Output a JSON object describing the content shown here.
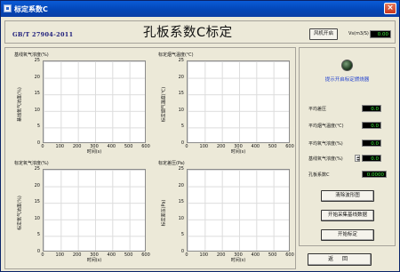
{
  "window": {
    "title": "标定系数C",
    "close_glyph": "×"
  },
  "header": {
    "standard_code": "GB/T 27904-2011",
    "title": "孔板系数C标定",
    "fan_button": "风机开启",
    "vs_label": "Vs(m3/S)",
    "vs_value": "0.00"
  },
  "charts": [
    {
      "title": "基线氧气浓度(%)",
      "ylabel": "基线氧气浓度(%)",
      "xlabel": "时间(s)",
      "yticks": [
        "25",
        "20",
        "15",
        "10",
        "5",
        "0"
      ],
      "xticks": [
        "0",
        "100",
        "200",
        "300",
        "400",
        "500",
        "600"
      ]
    },
    {
      "title": "标定烟气温度(℃)",
      "ylabel": "标定烟气温度(℃)",
      "xlabel": "时间(s)",
      "yticks": [
        "25",
        "20",
        "15",
        "10",
        "5",
        "0"
      ],
      "xticks": [
        "0",
        "100",
        "200",
        "300",
        "400",
        "500",
        "600"
      ]
    },
    {
      "title": "标定氧气浓度(%)",
      "ylabel": "标定氧气浓度(%)",
      "xlabel": "时间(s)",
      "yticks": [
        "25",
        "20",
        "15",
        "10",
        "5",
        "0"
      ],
      "xticks": [
        "0",
        "100",
        "200",
        "300",
        "400",
        "500",
        "600"
      ]
    },
    {
      "title": "标定差压(Pa)",
      "ylabel": "标定差压(Pa)",
      "xlabel": "时间(s)",
      "yticks": [
        "25",
        "20",
        "15",
        "10",
        "5",
        "0"
      ],
      "xticks": [
        "0",
        "100",
        "200",
        "300",
        "400",
        "500",
        "600"
      ]
    }
  ],
  "panel": {
    "led_label": "提示开启标定燃烧器",
    "measurements": [
      {
        "label": "平均差压",
        "value": "0.0"
      },
      {
        "label": "平均烟气温度(℃)",
        "value": "0.0"
      },
      {
        "label": "平均氧气浓度(%)",
        "value": "0.0"
      },
      {
        "label": "基线氧气浓度(%)",
        "value": "0.0"
      },
      {
        "label": "孔板系数C",
        "value": "0.0000"
      }
    ],
    "buttons": {
      "clear": "清除波形图",
      "collect": "开始采集基线数据",
      "calibrate": "开始标定"
    }
  },
  "footer": {
    "return_button": "返 回"
  },
  "colors": {
    "display_bg": "#000000",
    "display_fg": "#3ef03e",
    "led_off": "#1f3a1f",
    "title_bar": "#0a5bd6"
  }
}
